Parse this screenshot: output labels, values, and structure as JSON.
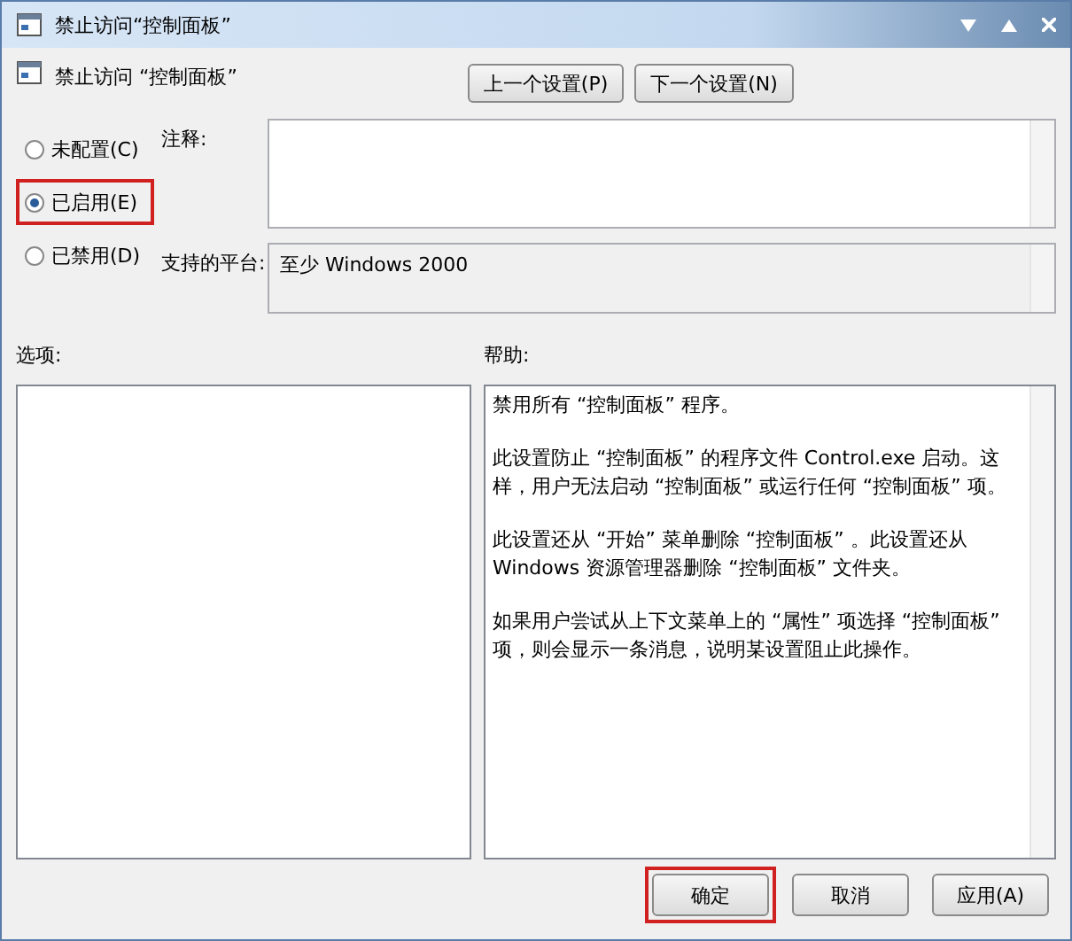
{
  "window": {
    "title": "禁止访问“控制面板”"
  },
  "header": {
    "title": "禁止访问 “控制面板”",
    "buttons": [
      {
        "label": "上一个设置(P)"
      },
      {
        "label": "下一个设置(N)"
      }
    ]
  },
  "options": [
    {
      "label": "未配置(C)",
      "selected": false,
      "highlighted": false
    },
    {
      "label": "已启用(E)",
      "selected": true,
      "highlighted": true
    },
    {
      "label": "已禁用(D)",
      "selected": false,
      "highlighted": false
    }
  ],
  "comment": {
    "label": "注释:"
  },
  "platform": {
    "label": "支持的平台:",
    "value": "至少 Windows 2000"
  },
  "options_panel": {
    "label": "选项:"
  },
  "help": {
    "label": "帮助:",
    "paragraphs": [
      "禁用所有 “控制面板” 程序。",
      "此设置防止 “控制面板” 的程序文件 Control.exe 启动。这样，用户无法启动 “控制面板” 或运行任何 “控制面板” 项。",
      "此设置还从 “开始” 菜单删除 “控制面板” 。此设置还从 Windows 资源管理器删除 “控制面板” 文件夹。",
      "如果用户尝试从上下文菜单上的 “属性” 项选择 “控制面板” 项，则会显示一条消息，说明某设置阻止此操作。"
    ]
  },
  "footer": {
    "buttons": [
      {
        "label": "确定",
        "highlighted": true
      },
      {
        "label": "取消",
        "highlighted": false
      },
      {
        "label": "应用(A)",
        "highlighted": false
      }
    ]
  }
}
